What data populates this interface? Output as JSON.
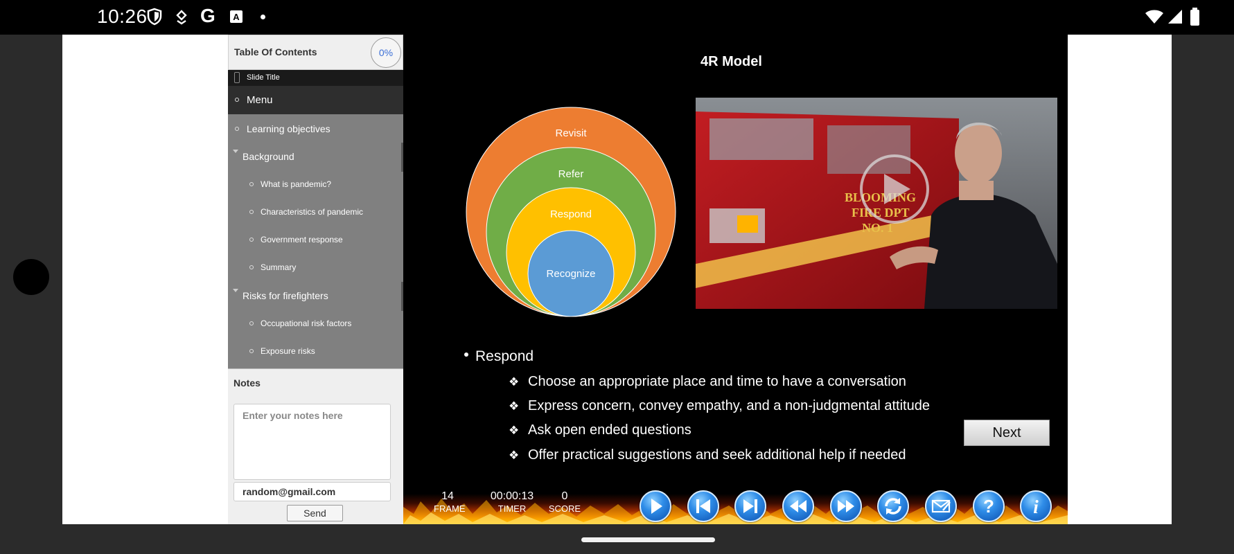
{
  "status_bar": {
    "time": "10:26",
    "icons": [
      "shield-icon",
      "download-icon",
      "google-icon",
      "a-box-icon",
      "dot-icon",
      "wifi-icon",
      "signal-icon",
      "battery-icon"
    ]
  },
  "toc": {
    "title": "Table Of Contents",
    "progress": "0%",
    "slide_title_label": "Slide Title",
    "items": [
      {
        "label": "Menu",
        "level": 0,
        "type": "bullet",
        "active": true
      },
      {
        "label": "Learning objectives",
        "level": 0,
        "type": "bullet"
      },
      {
        "label": "Background",
        "level": 0,
        "type": "expand"
      },
      {
        "label": "What is pandemic?",
        "level": 1,
        "type": "bullet"
      },
      {
        "label": "Characteristics of pandemic",
        "level": 1,
        "type": "bullet"
      },
      {
        "label": "Government response",
        "level": 1,
        "type": "bullet"
      },
      {
        "label": "Summary",
        "level": 1,
        "type": "bullet"
      },
      {
        "label": "Risks for firefighters",
        "level": 0,
        "type": "expand"
      },
      {
        "label": "Occupational risk factors",
        "level": 1,
        "type": "bullet"
      },
      {
        "label": "Exposure risks",
        "level": 1,
        "type": "bullet"
      }
    ]
  },
  "notes": {
    "title": "Notes",
    "placeholder": "Enter your notes here",
    "email": "random@gmail.com",
    "send_label": "Send"
  },
  "slide": {
    "title": "4R Model",
    "circles": [
      "Revisit",
      "Refer",
      "Respond",
      "Recognize"
    ],
    "circle_colors": [
      "#ED7D31",
      "#70AD47",
      "#FFC000",
      "#5B9BD5"
    ],
    "bullet_main": "Respond",
    "sub_bullets": [
      "Choose an appropriate place and time to have a conversation",
      "Express concern, convey empathy, and a non-judgmental attitude",
      "Ask open ended questions",
      "Offer practical suggestions and seek additional help if needed"
    ],
    "next_label": "Next",
    "video_truck_text": [
      "BLOOMING",
      "FIRE DPT",
      "NO. 1"
    ]
  },
  "controls": {
    "frame_value": "14",
    "frame_label": "FRAME",
    "timer_value": "00:00:13",
    "timer_label": "TIMER",
    "score_value": "0",
    "score_label": "SCORE",
    "buttons": [
      "play-icon",
      "skip-start-icon",
      "skip-end-icon",
      "rewind-icon",
      "fast-forward-icon",
      "refresh-icon",
      "email-icon",
      "help-icon",
      "info-icon"
    ]
  }
}
